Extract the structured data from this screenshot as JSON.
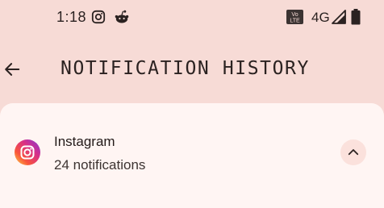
{
  "status_bar": {
    "time": "1:18",
    "volte_label_top": "Vo",
    "volte_label_bottom": "LTE",
    "network_type": "4G",
    "icons": [
      "instagram-icon",
      "reddit-icon",
      "volte-icon",
      "signal-icon",
      "battery-icon"
    ]
  },
  "app_bar": {
    "back_icon": "arrow-left-icon",
    "title": "NOTIFICATION HISTORY"
  },
  "notification_group": {
    "app_name": "Instagram",
    "count_label": "24 notifications",
    "app_icon": "instagram-icon",
    "collapse_icon": "chevron-up-icon"
  },
  "colors": {
    "background": "#f7dbd6",
    "card": "#fff5f3",
    "text": "#2b2221",
    "collapse_button_bg": "#fbe1dc"
  }
}
